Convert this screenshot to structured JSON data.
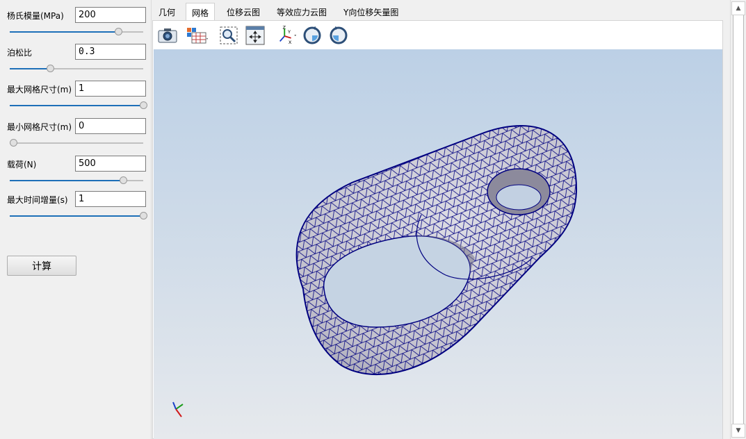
{
  "params": [
    {
      "label": "杨氏模量(MPa)",
      "value": "200",
      "slider_fraction": 0.81
    },
    {
      "label": "泊松比",
      "value": "0.3",
      "slider_fraction": 0.3
    },
    {
      "label": "最大网格尺寸(m)",
      "value": "1",
      "slider_fraction": 1.0
    },
    {
      "label": "最小网格尺寸(m)",
      "value": "0",
      "slider_fraction": 0.0
    },
    {
      "label": "载荷(N)",
      "value": "500",
      "slider_fraction": 0.85
    },
    {
      "label": "最大时间增量(s)",
      "value": "1",
      "slider_fraction": 1.0
    }
  ],
  "calc_button": "计算",
  "tabs": [
    {
      "label": "几何"
    },
    {
      "label": "网格"
    },
    {
      "label": "位移云图"
    },
    {
      "label": "等效应力云图"
    },
    {
      "label": "Y向位移矢量图"
    }
  ],
  "active_tab": 1,
  "toolbar_icons": [
    "camera-icon",
    "display-mode-icon",
    "zoom-box-icon",
    "fit-view-icon",
    "axes-orientation-icon",
    "rotate-cw-icon",
    "rotate-ccw-icon"
  ],
  "colors": {
    "mesh_edge": "#000080",
    "mesh_face": "#c9c8d0",
    "slider_fill": "#1d6fb8"
  }
}
